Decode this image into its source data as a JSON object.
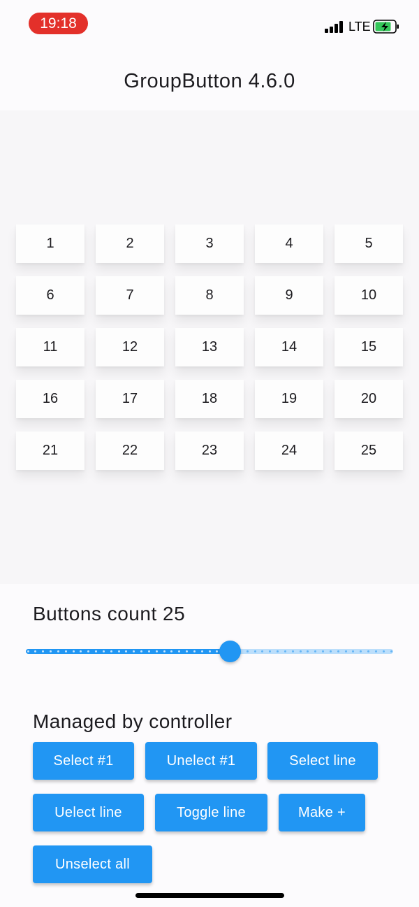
{
  "status_bar": {
    "time": "19:18",
    "network": "LTE",
    "icons": [
      "signal-icon",
      "battery-charging-icon"
    ],
    "time_pill_color": "#e3302a",
    "battery_color": "#34c759"
  },
  "app_bar": {
    "title": "GroupButton 4.6.0"
  },
  "group_buttons": {
    "items": [
      "1",
      "2",
      "3",
      "4",
      "5",
      "6",
      "7",
      "8",
      "9",
      "10",
      "11",
      "12",
      "13",
      "14",
      "15",
      "16",
      "17",
      "18",
      "19",
      "20",
      "21",
      "22",
      "23",
      "24",
      "25"
    ]
  },
  "slider": {
    "label": "Buttons count 25",
    "value": 25,
    "active_color": "#2196f3",
    "inactive_color": "#bbdefb"
  },
  "controller": {
    "title": "Managed by controller",
    "buttons": [
      "Select #1",
      "Unelect #1",
      "Select line",
      "Uelect line",
      "Toggle line",
      "Make +",
      "Unselect all"
    ],
    "button_color": "#2196f3"
  }
}
